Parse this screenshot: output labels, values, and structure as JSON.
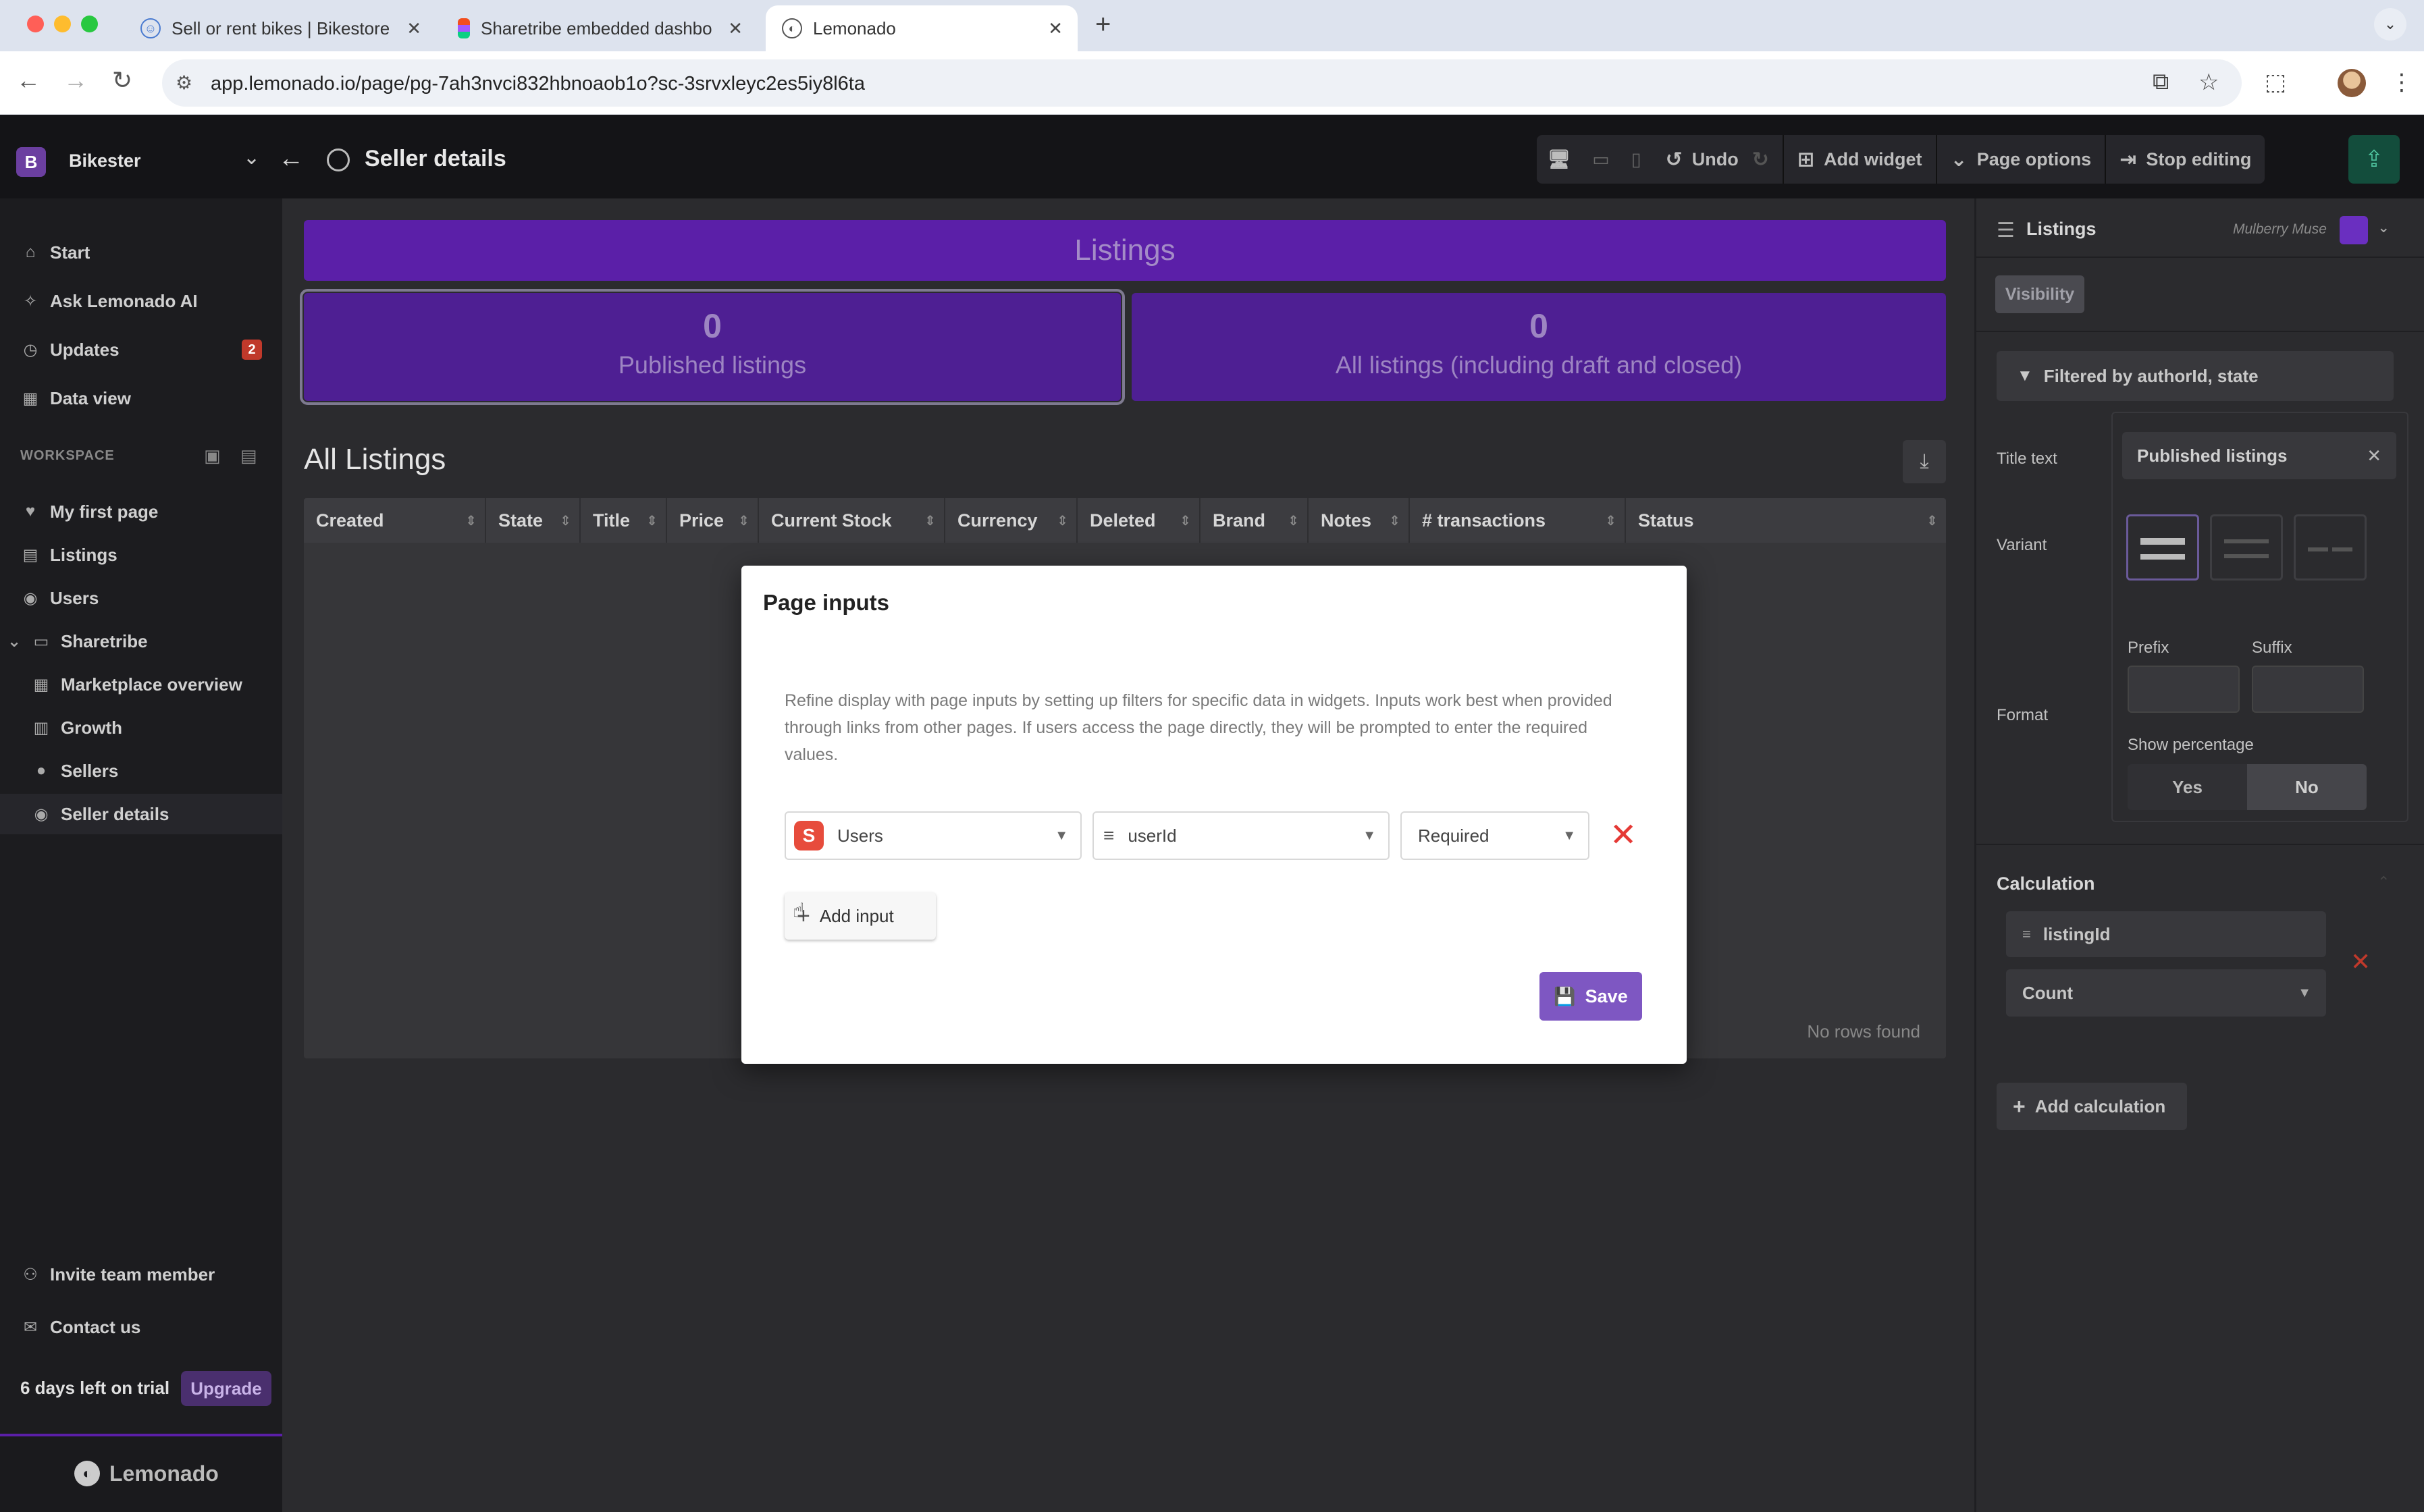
{
  "browser": {
    "tabs": [
      {
        "title": "Sell or rent bikes | Bikestore",
        "active": false
      },
      {
        "title": "Sharetribe embedded dashbo",
        "active": false
      },
      {
        "title": "Lemonado",
        "active": true
      }
    ],
    "new_tab": "+",
    "url": "app.lemonado.io/page/pg-7ah3nvci832hbnoaob1o?sc-3srvxleyc2es5iy8l6ta"
  },
  "topbar": {
    "workspace_initial": "B",
    "workspace_name": "Bikester",
    "page_title": "Seller details",
    "undo": "Undo",
    "add_widget": "Add widget",
    "page_options": "Page options",
    "stop_editing": "Stop editing"
  },
  "sidebar": {
    "main_items": [
      {
        "label": "Start",
        "icon": "home-icon"
      },
      {
        "label": "Ask Lemonado AI",
        "icon": "sparkle-icon"
      },
      {
        "label": "Updates",
        "icon": "clock-icon",
        "badge": "2"
      },
      {
        "label": "Data view",
        "icon": "table-icon"
      }
    ],
    "workspace_label": "WORKSPACE",
    "workspace_items": [
      {
        "label": "My first page",
        "icon": "heart-icon"
      },
      {
        "label": "Listings",
        "icon": "document-icon"
      },
      {
        "label": "Users",
        "icon": "user-circle-icon"
      },
      {
        "label": "Sharetribe",
        "icon": "folder-icon"
      },
      {
        "label": "Marketplace overview",
        "icon": "grid-icon"
      },
      {
        "label": "Growth",
        "icon": "chart-icon"
      },
      {
        "label": "Sellers",
        "icon": "dot-icon"
      },
      {
        "label": "Seller details",
        "icon": "user-circle-icon"
      }
    ],
    "invite": "Invite team member",
    "contact": "Contact us",
    "trial": "6 days left on trial",
    "upgrade": "Upgrade",
    "brand": "Lemonado"
  },
  "canvas": {
    "header": "Listings",
    "stats": [
      {
        "value": "0",
        "label": "Published listings"
      },
      {
        "value": "0",
        "label": "All listings (including draft and closed)"
      }
    ],
    "table_title": "All Listings",
    "columns": [
      "Created",
      "State",
      "Title",
      "Price",
      "Current Stock",
      "Currency",
      "Deleted",
      "Brand",
      "Notes",
      "# transactions",
      "Status"
    ],
    "empty": "No rows found"
  },
  "right_panel": {
    "title": "Listings",
    "theme": "Mulberry Muse",
    "theme_color": "#6a2fc0",
    "visibility": "Visibility",
    "filter": "Filtered by authorId, state",
    "title_text_label": "Title text",
    "title_text_value": "Published listings",
    "variant_label": "Variant",
    "format_label": "Format",
    "prefix_label": "Prefix",
    "suffix_label": "Suffix",
    "show_percentage_label": "Show percentage",
    "yes": "Yes",
    "no": "No",
    "calculation_label": "Calculation",
    "calc_field": "listingId",
    "calc_type": "Count",
    "add_calculation": "Add calculation"
  },
  "modal": {
    "title": "Page inputs",
    "description": "Refine display with page inputs by setting up filters for specific data in widgets. Inputs work best when provided through links from other pages. If users access the page directly, they will be prompted to enter the required values.",
    "source": "Users",
    "field": "userId",
    "requirement": "Required",
    "add_input": "Add input",
    "save": "Save"
  },
  "colors": {
    "accent_purple": "#5b1fa8",
    "save_button": "#7e57c2",
    "remove_red": "#e53935"
  }
}
